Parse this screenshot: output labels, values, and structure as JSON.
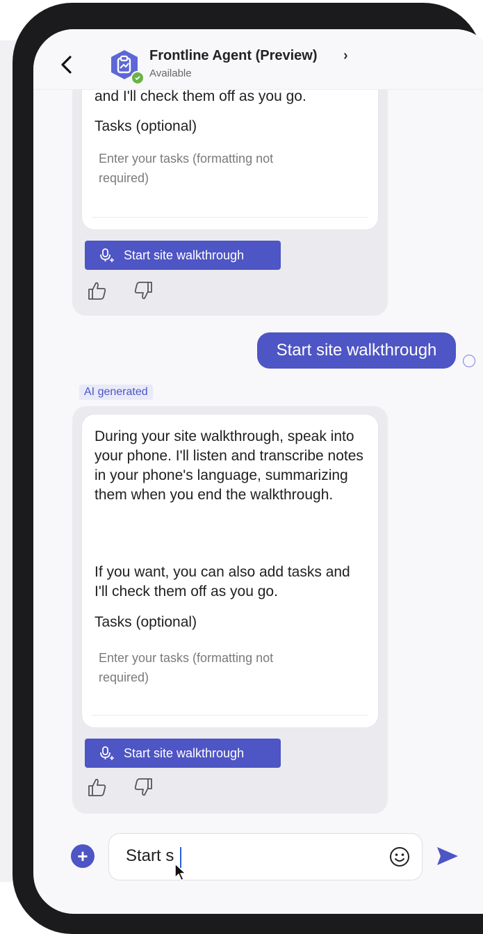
{
  "header": {
    "agent_name": "Frontline Agent (Preview)",
    "chevron": "›",
    "status": "Available",
    "back_icon": "chevron-left-icon"
  },
  "messages": {
    "first": {
      "partial_text": "and I'll check them off as you go.",
      "tasks_label": "Tasks (optional)",
      "tasks_placeholder": "Enter your tasks (formatting not required)",
      "button_label": "Start site walkthrough"
    },
    "user": {
      "text": "Start site walkthrough"
    },
    "ai_badge": "AI generated",
    "second": {
      "paragraph1": "During your site walkthrough, speak into your phone. I'll listen and transcribe notes in your phone's language, summarizing them when you end the walkthrough.",
      "paragraph2": "If you want, you can also add tasks and I'll check them off as you go.",
      "tasks_label": "Tasks (optional)",
      "tasks_placeholder": "Enter your tasks (formatting not required)",
      "button_label": "Start site walkthrough"
    }
  },
  "composer": {
    "value": "Start s",
    "plus_icon": "plus-icon",
    "emoji_icon": "emoji-icon",
    "send_icon": "send-icon"
  },
  "colors": {
    "accent": "#4e55c4",
    "bubble": "#ebebef",
    "frame": "#1b1b1d"
  }
}
